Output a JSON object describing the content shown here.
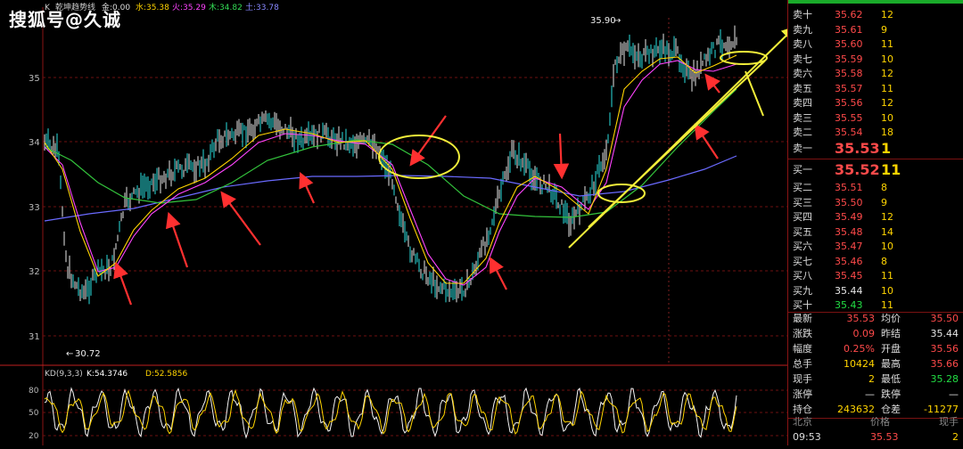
{
  "watermark": "搜狐号@久诚",
  "header": {
    "prefix": "K",
    "indicator": "乾坤趋势线",
    "jin": "金:0.00",
    "shui": "水:35.38",
    "huo": "火:35.29",
    "mu": "木:34.82",
    "tu": "土:33.78"
  },
  "price_axis": [
    "35",
    "34",
    "33",
    "32",
    "31"
  ],
  "annotations": {
    "high": "35.90",
    "low": "30.72"
  },
  "kd": {
    "label": "KD(9,3,3)",
    "k": "K:54.3746",
    "d": "D:52.5856",
    "axis": [
      "80",
      "50",
      "20"
    ]
  },
  "order_book": {
    "asks": [
      {
        "label": "卖十",
        "price": "35.62",
        "vol": "12"
      },
      {
        "label": "卖九",
        "price": "35.61",
        "vol": "9"
      },
      {
        "label": "卖八",
        "price": "35.60",
        "vol": "11"
      },
      {
        "label": "卖七",
        "price": "35.59",
        "vol": "10"
      },
      {
        "label": "卖六",
        "price": "35.58",
        "vol": "12"
      },
      {
        "label": "卖五",
        "price": "35.57",
        "vol": "11"
      },
      {
        "label": "卖四",
        "price": "35.56",
        "vol": "12"
      },
      {
        "label": "卖三",
        "price": "35.55",
        "vol": "10"
      },
      {
        "label": "卖二",
        "price": "35.54",
        "vol": "18"
      }
    ],
    "best_ask": {
      "label": "卖一",
      "price": "35.53",
      "vol": "1"
    },
    "best_bid": {
      "label": "买一",
      "price": "35.52",
      "vol": "11"
    },
    "bids": [
      {
        "label": "买二",
        "price": "35.51",
        "vol": "8"
      },
      {
        "label": "买三",
        "price": "35.50",
        "vol": "9"
      },
      {
        "label": "买四",
        "price": "35.49",
        "vol": "12"
      },
      {
        "label": "买五",
        "price": "35.48",
        "vol": "14"
      },
      {
        "label": "买六",
        "price": "35.47",
        "vol": "10"
      },
      {
        "label": "买七",
        "price": "35.46",
        "vol": "8"
      },
      {
        "label": "买八",
        "price": "35.45",
        "vol": "11"
      },
      {
        "label": "买九",
        "price": "35.44",
        "vol": "10"
      },
      {
        "label": "买十",
        "price": "35.43",
        "vol": "11"
      }
    ]
  },
  "stats": {
    "latest_label": "最新",
    "latest": "35.53",
    "avg_label": "均价",
    "avg": "35.50",
    "change_label": "涨跌",
    "change": "0.09",
    "prev_label": "昨结",
    "prev": "35.44",
    "range_label": "幅度",
    "range": "0.25%",
    "open_label": "开盘",
    "open": "35.56",
    "total_label": "总手",
    "total": "10424",
    "high_label": "最高",
    "high": "35.66",
    "now_label": "现手",
    "now": "2",
    "low_label": "最低",
    "low": "35.28",
    "limitup_label": "涨停",
    "limitup": "—",
    "limitdown_label": "跌停",
    "limitdown": "—",
    "oi_label": "持仓",
    "oi": "243632",
    "oidiff_label": "仓差",
    "oidiff": "-11277"
  },
  "trade_header": {
    "loc": "北京",
    "price": "价格",
    "qty": "现手"
  },
  "trade_row": {
    "time": "09:53",
    "price": "35.53",
    "qty": "2"
  }
}
